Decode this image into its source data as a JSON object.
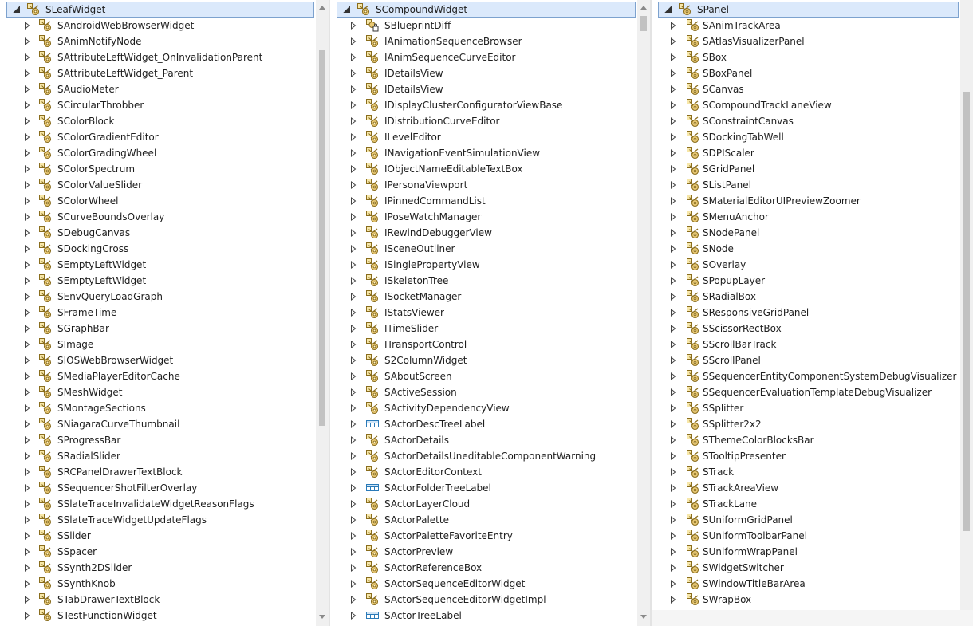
{
  "colors": {
    "selection_bg": "#dbe9fb",
    "selection_border": "#7da2ce",
    "scroll_thumb": "#c2c2c2"
  },
  "icons": {
    "class": "class-icon",
    "locked_class": "locked-class-icon",
    "struct": "struct-icon",
    "expand": "expand-triangle-icon",
    "expanded": "expanded-triangle-icon"
  },
  "panels": [
    {
      "root": "SLeafWidget",
      "scroll": {
        "thumb_start": 0.08,
        "thumb_end": 0.68
      },
      "items": [
        {
          "label": "SAndroidWebBrowserWidget",
          "icon": "class"
        },
        {
          "label": "SAnimNotifyNode",
          "icon": "class"
        },
        {
          "label": "SAttributeLeftWidget_OnInvalidationParent",
          "icon": "class"
        },
        {
          "label": "SAttributeLeftWidget_Parent",
          "icon": "class"
        },
        {
          "label": "SAudioMeter",
          "icon": "class"
        },
        {
          "label": "SCircularThrobber",
          "icon": "class"
        },
        {
          "label": "SColorBlock",
          "icon": "class"
        },
        {
          "label": "SColorGradientEditor",
          "icon": "class"
        },
        {
          "label": "SColorGradingWheel",
          "icon": "class"
        },
        {
          "label": "SColorSpectrum",
          "icon": "class"
        },
        {
          "label": "SColorValueSlider",
          "icon": "class"
        },
        {
          "label": "SColorWheel",
          "icon": "class"
        },
        {
          "label": "SCurveBoundsOverlay",
          "icon": "class"
        },
        {
          "label": "SDebugCanvas",
          "icon": "class"
        },
        {
          "label": "SDockingCross",
          "icon": "class"
        },
        {
          "label": "SEmptyLeftWidget",
          "icon": "class"
        },
        {
          "label": "SEmptyLeftWidget",
          "icon": "class"
        },
        {
          "label": "SEnvQueryLoadGraph",
          "icon": "class"
        },
        {
          "label": "SFrameTime",
          "icon": "class"
        },
        {
          "label": "SGraphBar",
          "icon": "class"
        },
        {
          "label": "SImage",
          "icon": "class"
        },
        {
          "label": "SIOSWebBrowserWidget",
          "icon": "class"
        },
        {
          "label": "SMediaPlayerEditorCache",
          "icon": "class"
        },
        {
          "label": "SMeshWidget",
          "icon": "class"
        },
        {
          "label": "SMontageSections",
          "icon": "class"
        },
        {
          "label": "SNiagaraCurveThumbnail",
          "icon": "class"
        },
        {
          "label": "SProgressBar",
          "icon": "class"
        },
        {
          "label": "SRadialSlider",
          "icon": "class"
        },
        {
          "label": "SRCPanelDrawerTextBlock",
          "icon": "class"
        },
        {
          "label": "SSequencerShotFilterOverlay",
          "icon": "class"
        },
        {
          "label": "SSlateTraceInvalidateWidgetReasonFlags",
          "icon": "class"
        },
        {
          "label": "SSlateTraceWidgetUpdateFlags",
          "icon": "class"
        },
        {
          "label": "SSlider",
          "icon": "class"
        },
        {
          "label": "SSpacer",
          "icon": "class"
        },
        {
          "label": "SSynth2DSlider",
          "icon": "class"
        },
        {
          "label": "SSynthKnob",
          "icon": "class"
        },
        {
          "label": "STabDrawerTextBlock",
          "icon": "class"
        },
        {
          "label": "STestFunctionWidget",
          "icon": "class"
        }
      ]
    },
    {
      "root": "SCompoundWidget",
      "scroll": {
        "thumb_start": 0.025,
        "thumb_end": 0.05
      },
      "items": [
        {
          "label": "SBlueprintDiff",
          "icon": "locked_class"
        },
        {
          "label": "IAnimationSequenceBrowser",
          "icon": "class"
        },
        {
          "label": "IAnimSequenceCurveEditor",
          "icon": "class"
        },
        {
          "label": "IDetailsView",
          "icon": "class"
        },
        {
          "label": "IDetailsView",
          "icon": "class"
        },
        {
          "label": "IDisplayClusterConfiguratorViewBase",
          "icon": "class"
        },
        {
          "label": "IDistributionCurveEditor",
          "icon": "class"
        },
        {
          "label": "ILevelEditor",
          "icon": "class"
        },
        {
          "label": "INavigationEventSimulationView",
          "icon": "class"
        },
        {
          "label": "IObjectNameEditableTextBox",
          "icon": "class"
        },
        {
          "label": "IPersonaViewport",
          "icon": "class"
        },
        {
          "label": "IPinnedCommandList",
          "icon": "class"
        },
        {
          "label": "IPoseWatchManager",
          "icon": "class"
        },
        {
          "label": "IRewindDebuggerView",
          "icon": "class"
        },
        {
          "label": "ISceneOutliner",
          "icon": "class"
        },
        {
          "label": "ISinglePropertyView",
          "icon": "class"
        },
        {
          "label": "ISkeletonTree",
          "icon": "class"
        },
        {
          "label": "ISocketManager",
          "icon": "class"
        },
        {
          "label": "IStatsViewer",
          "icon": "class"
        },
        {
          "label": "ITimeSlider",
          "icon": "class"
        },
        {
          "label": "ITransportControl",
          "icon": "class"
        },
        {
          "label": "S2ColumnWidget",
          "icon": "class"
        },
        {
          "label": "SAboutScreen",
          "icon": "class"
        },
        {
          "label": "SActiveSession",
          "icon": "class"
        },
        {
          "label": "SActivityDependencyView",
          "icon": "class"
        },
        {
          "label": "SActorDescTreeLabel",
          "icon": "struct"
        },
        {
          "label": "SActorDetails",
          "icon": "class"
        },
        {
          "label": "SActorDetailsUneditableComponentWarning",
          "icon": "class"
        },
        {
          "label": "SActorEditorContext",
          "icon": "class"
        },
        {
          "label": "SActorFolderTreeLabel",
          "icon": "struct"
        },
        {
          "label": "SActorLayerCloud",
          "icon": "class"
        },
        {
          "label": "SActorPalette",
          "icon": "class"
        },
        {
          "label": "SActorPaletteFavoriteEntry",
          "icon": "class"
        },
        {
          "label": "SActorPreview",
          "icon": "class"
        },
        {
          "label": "SActorReferenceBox",
          "icon": "class"
        },
        {
          "label": "SActorSequenceEditorWidget",
          "icon": "class"
        },
        {
          "label": "SActorSequenceEditorWidgetImpl",
          "icon": "class"
        },
        {
          "label": "SActorTreeLabel",
          "icon": "struct"
        }
      ]
    },
    {
      "root": "SPanel",
      "scroll": {
        "thumb_start": 0.15,
        "thumb_end": 0.87
      },
      "items": [
        {
          "label": "SAnimTrackArea",
          "icon": "class"
        },
        {
          "label": "SAtlasVisualizerPanel",
          "icon": "class"
        },
        {
          "label": "SBox",
          "icon": "class"
        },
        {
          "label": "SBoxPanel",
          "icon": "class"
        },
        {
          "label": "SCanvas",
          "icon": "class"
        },
        {
          "label": "SCompoundTrackLaneView",
          "icon": "class"
        },
        {
          "label": "SConstraintCanvas",
          "icon": "class"
        },
        {
          "label": "SDockingTabWell",
          "icon": "class"
        },
        {
          "label": "SDPIScaler",
          "icon": "class"
        },
        {
          "label": "SGridPanel",
          "icon": "class"
        },
        {
          "label": "SListPanel",
          "icon": "class"
        },
        {
          "label": "SMaterialEditorUIPreviewZoomer",
          "icon": "class"
        },
        {
          "label": "SMenuAnchor",
          "icon": "class"
        },
        {
          "label": "SNodePanel",
          "icon": "class"
        },
        {
          "label": "SNode",
          "icon": "class"
        },
        {
          "label": "SOverlay",
          "icon": "class"
        },
        {
          "label": "SPopupLayer",
          "icon": "class"
        },
        {
          "label": "SRadialBox",
          "icon": "class"
        },
        {
          "label": "SResponsiveGridPanel",
          "icon": "class"
        },
        {
          "label": "SScissorRectBox",
          "icon": "class"
        },
        {
          "label": "SScrollBarTrack",
          "icon": "class"
        },
        {
          "label": "SScrollPanel",
          "icon": "class"
        },
        {
          "label": "SSequencerEntityComponentSystemDebugVisualizer",
          "icon": "class"
        },
        {
          "label": "SSequencerEvaluationTemplateDebugVisualizer",
          "icon": "class"
        },
        {
          "label": "SSplitter",
          "icon": "class"
        },
        {
          "label": "SSplitter2x2",
          "icon": "class"
        },
        {
          "label": "SThemeColorBlocksBar",
          "icon": "class"
        },
        {
          "label": "STooltipPresenter",
          "icon": "class"
        },
        {
          "label": "STrack",
          "icon": "class"
        },
        {
          "label": "STrackAreaView",
          "icon": "class"
        },
        {
          "label": "STrackLane",
          "icon": "class"
        },
        {
          "label": "SUniformGridPanel",
          "icon": "class"
        },
        {
          "label": "SUniformToolbarPanel",
          "icon": "class"
        },
        {
          "label": "SUniformWrapPanel",
          "icon": "class"
        },
        {
          "label": "SWidgetSwitcher",
          "icon": "class"
        },
        {
          "label": "SWindowTitleBarArea",
          "icon": "class"
        },
        {
          "label": "SWrapBox",
          "icon": "class"
        }
      ]
    }
  ]
}
